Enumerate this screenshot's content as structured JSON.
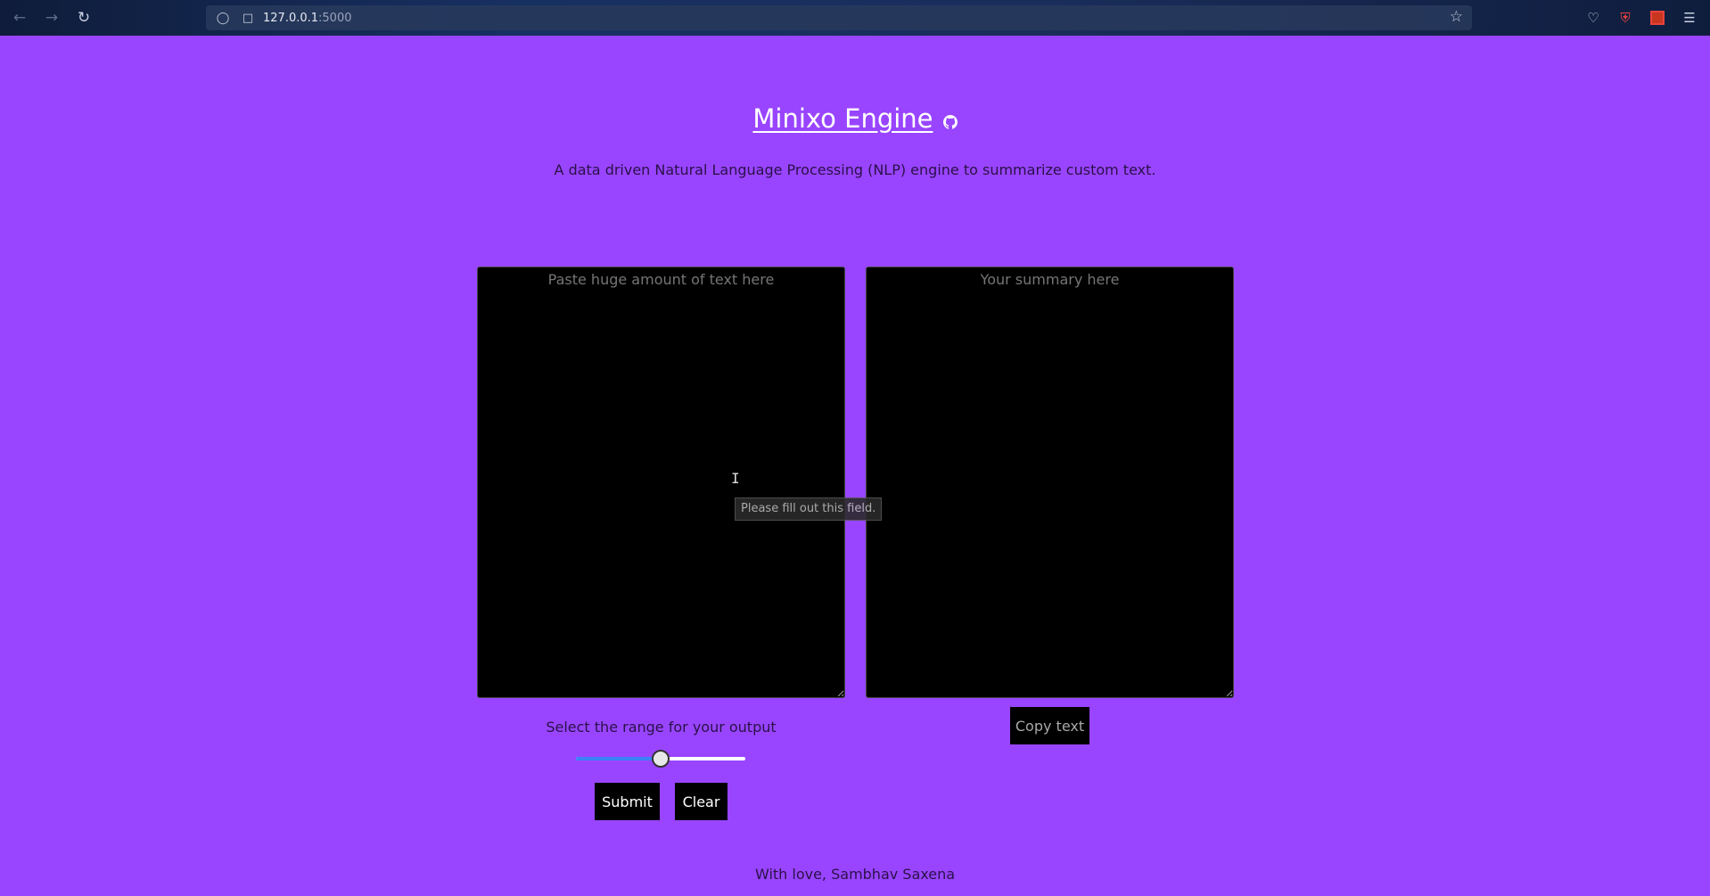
{
  "browser": {
    "url_host": "127.0.0.1",
    "url_port": ":5000",
    "icons": {
      "back": "back-arrow-icon",
      "forward": "forward-arrow-icon",
      "reload": "reload-icon",
      "star": "bookmark-star-icon",
      "pocket": "pocket-icon",
      "shield": "shield-icon",
      "extension": "extension-icon",
      "menu": "hamburger-menu-icon"
    }
  },
  "header": {
    "title": "Minixo Engine",
    "subtitle": "A data driven Natural Language Processing (NLP) engine to summarize custom text."
  },
  "input": {
    "placeholder": "Paste huge amount of text here",
    "validation_tooltip": "Please fill out this field."
  },
  "output": {
    "placeholder": "Your summary here",
    "copy_label": "Copy text"
  },
  "controls": {
    "range_label": "Select the range for your output",
    "slider_value": 0.5,
    "submit_label": "Submit",
    "clear_label": "Clear"
  },
  "footer": {
    "text": "With love, Sambhav Saxena"
  },
  "colors": {
    "page_background": "#9945ff",
    "text_dark": "#2a1147",
    "slider_fill": "#3b82f6"
  }
}
